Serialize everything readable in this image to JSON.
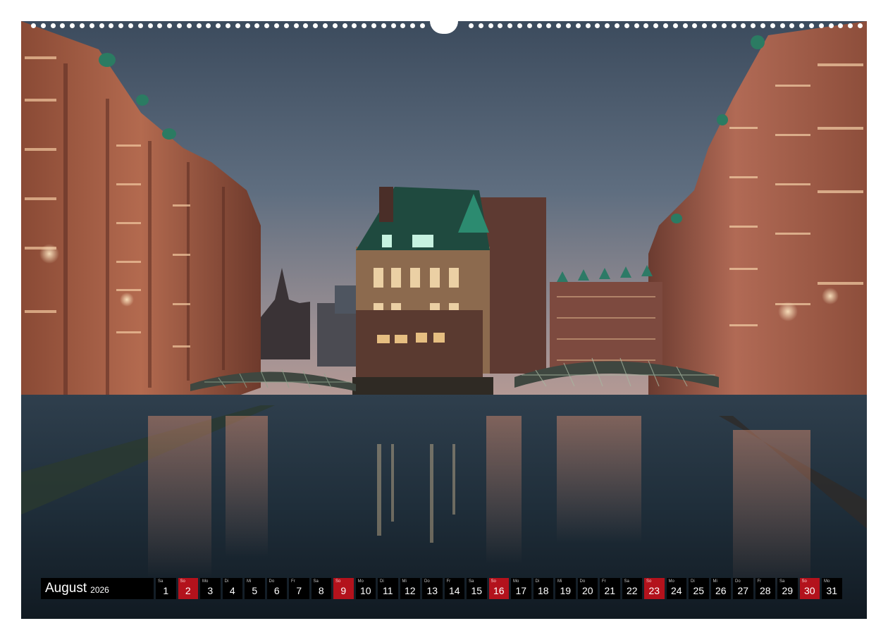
{
  "calendar": {
    "month": "August",
    "year": "2026",
    "days": [
      {
        "wd": "Sa",
        "d": "1",
        "sunday": false
      },
      {
        "wd": "So",
        "d": "2",
        "sunday": true
      },
      {
        "wd": "Mo",
        "d": "3",
        "sunday": false
      },
      {
        "wd": "Di",
        "d": "4",
        "sunday": false
      },
      {
        "wd": "Mi",
        "d": "5",
        "sunday": false
      },
      {
        "wd": "Do",
        "d": "6",
        "sunday": false
      },
      {
        "wd": "Fr",
        "d": "7",
        "sunday": false
      },
      {
        "wd": "Sa",
        "d": "8",
        "sunday": false
      },
      {
        "wd": "So",
        "d": "9",
        "sunday": true
      },
      {
        "wd": "Mo",
        "d": "10",
        "sunday": false
      },
      {
        "wd": "Di",
        "d": "11",
        "sunday": false
      },
      {
        "wd": "Mi",
        "d": "12",
        "sunday": false
      },
      {
        "wd": "Do",
        "d": "13",
        "sunday": false
      },
      {
        "wd": "Fr",
        "d": "14",
        "sunday": false
      },
      {
        "wd": "Sa",
        "d": "15",
        "sunday": false
      },
      {
        "wd": "So",
        "d": "16",
        "sunday": true
      },
      {
        "wd": "Mo",
        "d": "17",
        "sunday": false
      },
      {
        "wd": "Di",
        "d": "18",
        "sunday": false
      },
      {
        "wd": "Mi",
        "d": "19",
        "sunday": false
      },
      {
        "wd": "Do",
        "d": "20",
        "sunday": false
      },
      {
        "wd": "Fr",
        "d": "21",
        "sunday": false
      },
      {
        "wd": "Sa",
        "d": "22",
        "sunday": false
      },
      {
        "wd": "So",
        "d": "23",
        "sunday": true
      },
      {
        "wd": "Mo",
        "d": "24",
        "sunday": false
      },
      {
        "wd": "Di",
        "d": "25",
        "sunday": false
      },
      {
        "wd": "Mi",
        "d": "26",
        "sunday": false
      },
      {
        "wd": "Do",
        "d": "27",
        "sunday": false
      },
      {
        "wd": "Fr",
        "d": "28",
        "sunday": false
      },
      {
        "wd": "Sa",
        "d": "29",
        "sunday": false
      },
      {
        "wd": "So",
        "d": "30",
        "sunday": true
      },
      {
        "wd": "Mo",
        "d": "31",
        "sunday": false
      }
    ]
  },
  "colors": {
    "sunday_accent": "#b3121c",
    "bar_background": "#000000"
  }
}
